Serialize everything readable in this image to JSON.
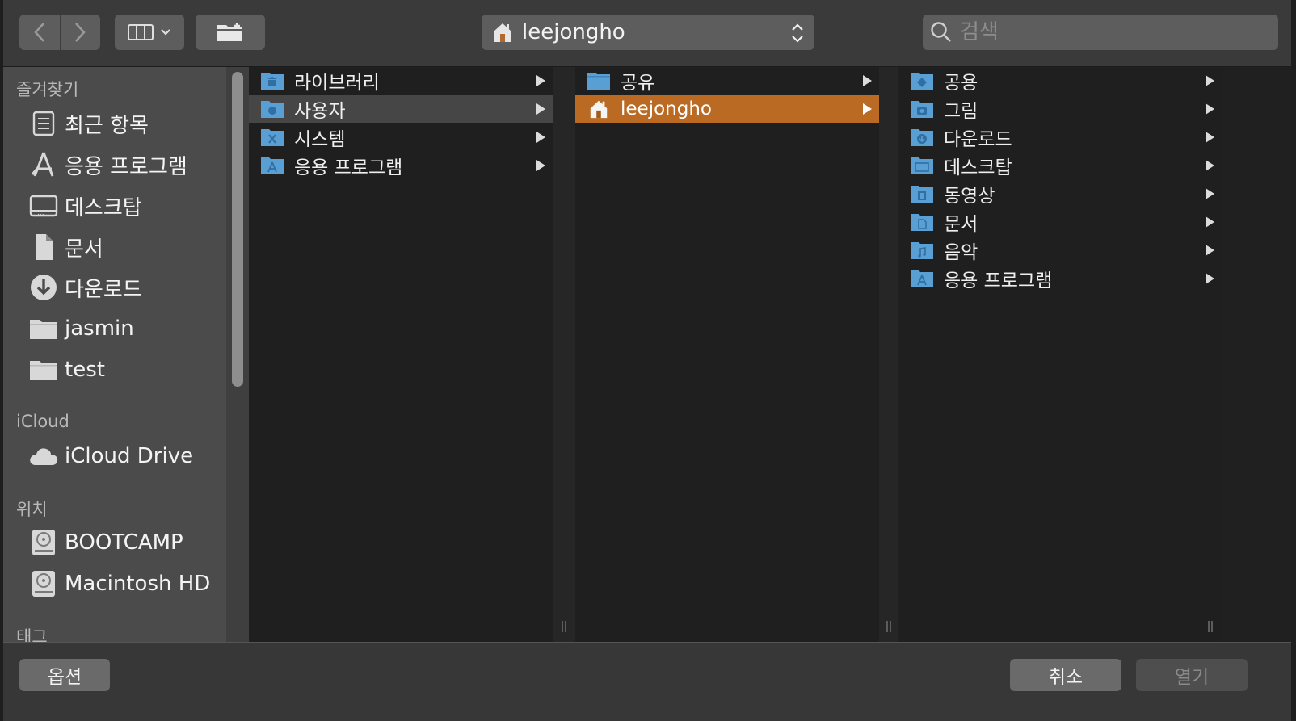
{
  "toolbar": {
    "back_icon": "chevron-left-icon",
    "forward_icon": "chevron-right-icon",
    "view_icon": "columns-view-icon",
    "new_folder_icon": "new-folder-icon",
    "path_label": "leejongho",
    "search_placeholder": "검색"
  },
  "sidebar": {
    "favorites_header": "즐겨찾기",
    "favorites": [
      {
        "label": "최근 항목",
        "icon": "recents-icon"
      },
      {
        "label": "응용 프로그램",
        "icon": "applications-icon"
      },
      {
        "label": "데스크탑",
        "icon": "desktop-icon"
      },
      {
        "label": "문서",
        "icon": "documents-icon"
      },
      {
        "label": "다운로드",
        "icon": "downloads-icon"
      },
      {
        "label": "jasmin",
        "icon": "folder-icon"
      },
      {
        "label": "test",
        "icon": "folder-icon"
      }
    ],
    "icloud_header": "iCloud",
    "icloud": [
      {
        "label": "iCloud Drive",
        "icon": "cloud-icon"
      }
    ],
    "locations_header": "위치",
    "locations": [
      {
        "label": "BOOTCAMP",
        "icon": "disk-icon"
      },
      {
        "label": "Macintosh HD",
        "icon": "disk-icon"
      }
    ],
    "tags_header": "태그"
  },
  "columns": {
    "col1": [
      {
        "label": "라이브러리",
        "icon": "library-folder-icon"
      },
      {
        "label": "사용자",
        "icon": "users-folder-icon"
      },
      {
        "label": "시스템",
        "icon": "system-folder-icon"
      },
      {
        "label": "응용 프로그램",
        "icon": "applications-folder-icon"
      }
    ],
    "col2": [
      {
        "label": "공유",
        "icon": "folder-icon"
      },
      {
        "label": "leejongho",
        "icon": "home-icon"
      }
    ],
    "col3": [
      {
        "label": "공용",
        "icon": "public-folder-icon"
      },
      {
        "label": "그림",
        "icon": "pictures-folder-icon"
      },
      {
        "label": "다운로드",
        "icon": "downloads-folder-icon"
      },
      {
        "label": "데스크탑",
        "icon": "desktop-folder-icon"
      },
      {
        "label": "동영상",
        "icon": "movies-folder-icon"
      },
      {
        "label": "문서",
        "icon": "documents-folder-icon"
      },
      {
        "label": "음악",
        "icon": "music-folder-icon"
      },
      {
        "label": "응용 프로그램",
        "icon": "applications-folder-icon"
      }
    ]
  },
  "footer": {
    "options_label": "옵션",
    "cancel_label": "취소",
    "open_label": "열기"
  },
  "colors": {
    "selection_orange": "#bb6a23",
    "folder_blue": "#5a9fd4"
  }
}
